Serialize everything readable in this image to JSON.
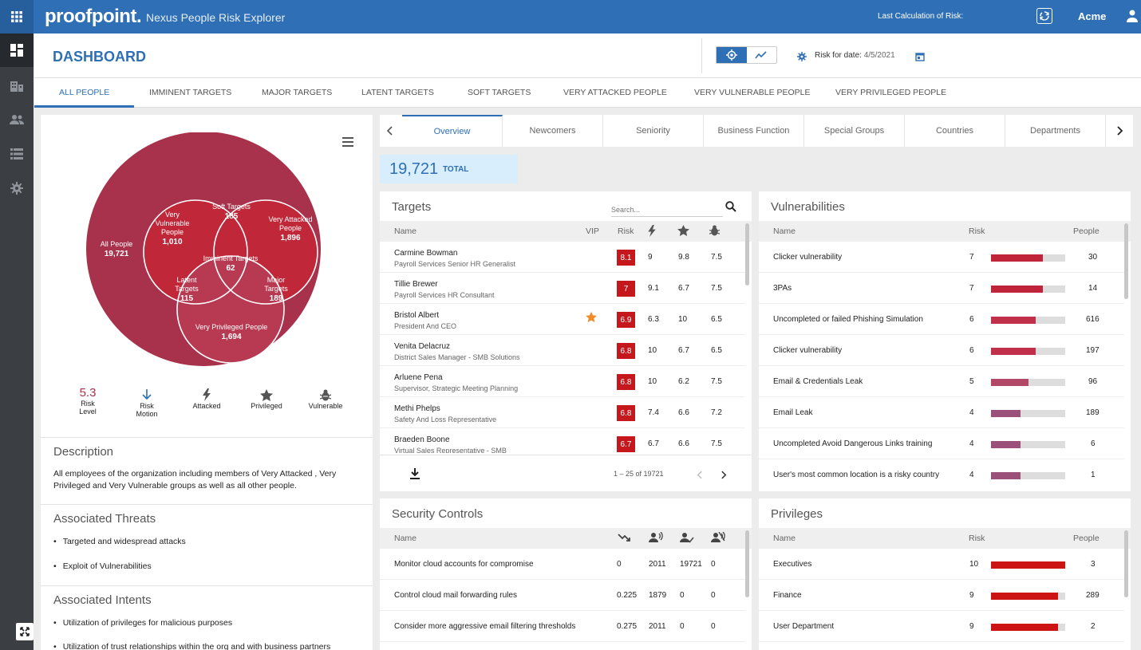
{
  "topbar": {
    "logo": "proofpoint.",
    "app_title": "Nexus People Risk Explorer",
    "last_calc_label": "Last Calculation of Risk:",
    "tenant": "Acme"
  },
  "header": {
    "title": "DASHBOARD",
    "risk_date_label": "Risk for date:",
    "risk_date_value": "4/5/2021"
  },
  "tabs": [
    "ALL PEOPLE",
    "IMMINENT TARGETS",
    "MAJOR TARGETS",
    "LATENT TARGETS",
    "SOFT TARGETS",
    "VERY ATTACKED PEOPLE",
    "VERY VULNERABLE PEOPLE",
    "VERY PRIVILEGED PEOPLE"
  ],
  "venn": {
    "all_people": {
      "label": "All People",
      "value": "19,721"
    },
    "very_vulnerable": {
      "label1": "Very",
      "label2": "Vulnerable",
      "label3": "People",
      "value": "1,010"
    },
    "soft_targets": {
      "label": "Soft Targets",
      "value": "185"
    },
    "very_attacked": {
      "label1": "Very Attacked",
      "label2": "People",
      "value": "1,896"
    },
    "imminent_targets": {
      "label": "Imminent Targets",
      "value": "62"
    },
    "latent_targets": {
      "label1": "Latent",
      "label2": "Targets",
      "value": "115"
    },
    "major_targets": {
      "label1": "Major",
      "label2": "Targets",
      "value": "189"
    },
    "very_privileged": {
      "label": "Very Privileged People",
      "value": "1,694"
    }
  },
  "legend": {
    "risk_level_value": "5.3",
    "risk_level_label1": "Risk",
    "risk_level_label2": "Level",
    "risk_motion_label1": "Risk",
    "risk_motion_label2": "Motion",
    "attacked": "Attacked",
    "privileged": "Privileged",
    "vulnerable": "Vulnerable"
  },
  "description": {
    "title": "Description",
    "text": "All employees of the organization including members of Very Attacked , Very Privileged and Very Vulnerable groups as well as all other people."
  },
  "threats": {
    "title": "Associated Threats",
    "items": [
      "Targeted and widespread attacks",
      "Exploit of Vulnerabilities"
    ]
  },
  "intents": {
    "title": "Associated Intents",
    "items": [
      "Utilization of privileges for malicious purposes",
      "Utilization of trust relationships within the org and with business partners"
    ]
  },
  "subtabs": [
    "Overview",
    "Newcomers",
    "Seniority",
    "Business Function",
    "Special Groups",
    "Countries",
    "Departments"
  ],
  "total": {
    "value": "19,721",
    "label": "TOTAL"
  },
  "targets": {
    "title": "Targets",
    "search_placeholder": "Search...",
    "columns": {
      "name": "Name",
      "vip": "VIP",
      "risk": "Risk"
    },
    "rows": [
      {
        "name": "Carmine Bowman",
        "title": "Payroll Services Senior HR Generalist",
        "vip": false,
        "risk": "8.1",
        "attacked": "9",
        "privileged": "9.8",
        "vulnerable": "7.5"
      },
      {
        "name": "Tillie Brewer",
        "title": "Payroll Services HR Consultant",
        "vip": false,
        "risk": "7",
        "attacked": "9.1",
        "privileged": "6.7",
        "vulnerable": "7.5"
      },
      {
        "name": "Bristol Albert",
        "title": "President And CEO",
        "vip": true,
        "risk": "6.9",
        "attacked": "6.3",
        "privileged": "10",
        "vulnerable": "6.5"
      },
      {
        "name": "Venita Delacruz",
        "title": "District Sales Manager - SMB Solutions",
        "vip": false,
        "risk": "6.8",
        "attacked": "10",
        "privileged": "6.7",
        "vulnerable": "6.5"
      },
      {
        "name": "Arluene Pena",
        "title": "Supervisor, Strategic Meeting Planning",
        "vip": false,
        "risk": "6.8",
        "attacked": "10",
        "privileged": "6.2",
        "vulnerable": "7.5"
      },
      {
        "name": "Methi Phelps",
        "title": "Safety And Loss Representative",
        "vip": false,
        "risk": "6.8",
        "attacked": "7.4",
        "privileged": "6.6",
        "vulnerable": "7.2"
      },
      {
        "name": "Braeden Boone",
        "title": "Virtual Sales Representative - SMB",
        "vip": false,
        "risk": "6.7",
        "attacked": "6.7",
        "privileged": "6.6",
        "vulnerable": "7.5"
      }
    ],
    "pagination": "1 – 25 of 19721"
  },
  "vulnerabilities": {
    "title": "Vulnerabilities",
    "columns": {
      "name": "Name",
      "risk": "Risk",
      "people": "People"
    },
    "rows": [
      {
        "name": "Clicker vulnerability",
        "risk": "7",
        "fraction": 0.7,
        "color": "#c0243a",
        "people": "30"
      },
      {
        "name": "3PAs",
        "risk": "7",
        "fraction": 0.7,
        "color": "#c0243a",
        "people": "14"
      },
      {
        "name": "Uncompleted or failed Phishing Simulation",
        "risk": "6",
        "fraction": 0.6,
        "color": "#c0304a",
        "people": "616"
      },
      {
        "name": "Clicker vulnerability",
        "risk": "6",
        "fraction": 0.6,
        "color": "#c0304a",
        "people": "197"
      },
      {
        "name": "Email & Credentials Leak",
        "risk": "5",
        "fraction": 0.5,
        "color": "#b24867",
        "people": "96"
      },
      {
        "name": "Email Leak",
        "risk": "4",
        "fraction": 0.4,
        "color": "#9a5079",
        "people": "189"
      },
      {
        "name": "Uncompleted Avoid Dangerous Links training",
        "risk": "4",
        "fraction": 0.4,
        "color": "#9a5079",
        "people": "6"
      },
      {
        "name": "User's most common location is a risky country",
        "risk": "4",
        "fraction": 0.4,
        "color": "#9a5079",
        "people": "1"
      }
    ]
  },
  "security_controls": {
    "title": "Security Controls",
    "columns": {
      "name": "Name"
    },
    "rows": [
      {
        "name": "Monitor cloud accounts for compromise",
        "v1": "0",
        "v2": "2011",
        "v3": "19721",
        "v4": "0"
      },
      {
        "name": "Control cloud mail forwarding rules",
        "v1": "0.225",
        "v2": "1879",
        "v3": "0",
        "v4": "0"
      },
      {
        "name": "Consider more aggressive email filtering thresholds",
        "v1": "0.275",
        "v2": "2011",
        "v3": "0",
        "v4": "0"
      }
    ]
  },
  "privileges": {
    "title": "Privileges",
    "columns": {
      "name": "Name",
      "risk": "Risk",
      "people": "People"
    },
    "rows": [
      {
        "name": "Executives",
        "risk": "10",
        "fraction": 1.0,
        "color": "#cc1414",
        "people": "3"
      },
      {
        "name": "Finance",
        "risk": "9",
        "fraction": 0.9,
        "color": "#cc1414",
        "people": "289"
      },
      {
        "name": "User Department",
        "risk": "9",
        "fraction": 0.9,
        "color": "#cc1414",
        "people": "2"
      }
    ]
  }
}
